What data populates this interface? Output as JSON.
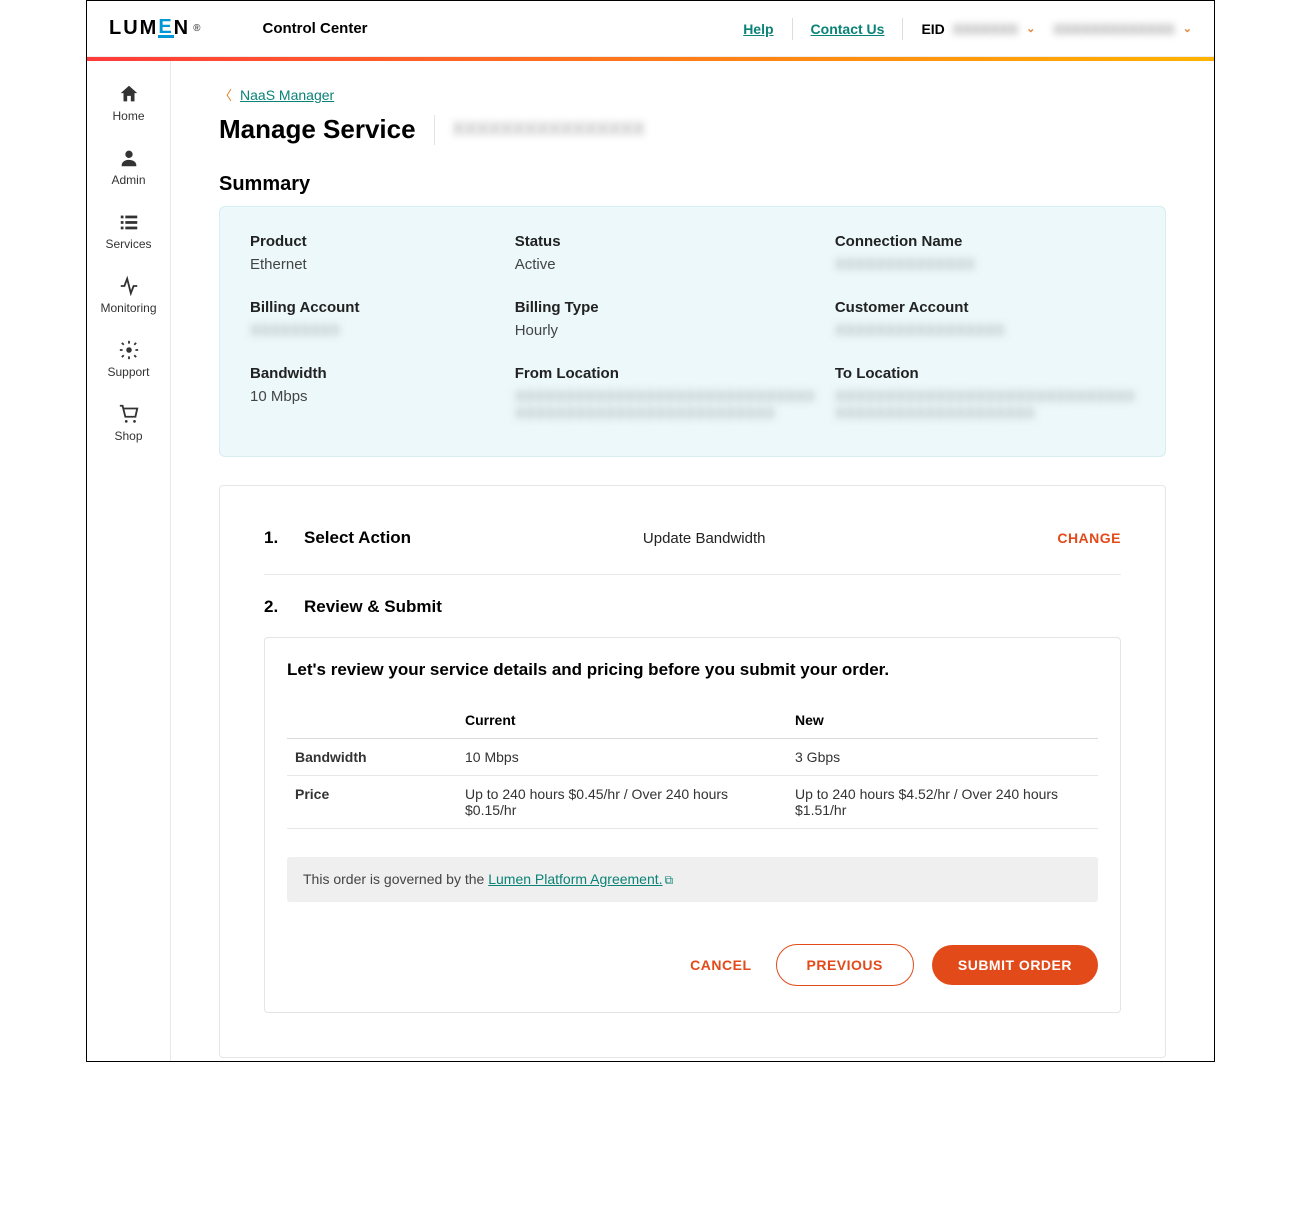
{
  "header": {
    "logo_text": "LUMEN",
    "app_name": "Control Center",
    "help": "Help",
    "contact": "Contact Us",
    "eid_label": "EID",
    "eid_value": "XXXXXXX",
    "user_value": "XXXXXXXXXXXXX"
  },
  "sidebar": {
    "items": [
      {
        "label": "Home"
      },
      {
        "label": "Admin"
      },
      {
        "label": "Services"
      },
      {
        "label": "Monitoring"
      },
      {
        "label": "Support"
      },
      {
        "label": "Shop"
      }
    ]
  },
  "breadcrumb": {
    "link": "NaaS Manager"
  },
  "page": {
    "title": "Manage Service",
    "subtitle": "XXXXXXXXXXXXXXXX"
  },
  "summary": {
    "heading": "Summary",
    "fields": {
      "product": {
        "label": "Product",
        "value": "Ethernet"
      },
      "status": {
        "label": "Status",
        "value": "Active"
      },
      "connection_name": {
        "label": "Connection Name",
        "value": "XXXXXXXXXXXXXX"
      },
      "billing_account": {
        "label": "Billing Account",
        "value": "XXXXXXXXX"
      },
      "billing_type": {
        "label": "Billing Type",
        "value": "Hourly"
      },
      "customer_account": {
        "label": "Customer Account",
        "value": "XXXXXXXXXXXXXXXXX"
      },
      "bandwidth": {
        "label": "Bandwidth",
        "value": "10 Mbps"
      },
      "from_location": {
        "label": "From Location",
        "value": "XXXXXXXXXXXXXXXXXXXXXXXXXXXXXX XXXXXXXXXXXXXXXXXXXXXXXXXX"
      },
      "to_location": {
        "label": "To Location",
        "value": "XXXXXXXXXXXXXXXXXXXXXXXXXXXXXX XXXXXXXXXXXXXXXXXXXX"
      }
    }
  },
  "wizard": {
    "step1": {
      "num": "1.",
      "title": "Select Action",
      "value": "Update Bandwidth",
      "change": "CHANGE"
    },
    "step2": {
      "num": "2.",
      "title": "Review & Submit"
    },
    "review": {
      "heading": "Let's review your service details and pricing before you submit your order.",
      "columns": {
        "current": "Current",
        "new": "New"
      },
      "rows": [
        {
          "label": "Bandwidth",
          "current": "10 Mbps",
          "new": "3 Gbps"
        },
        {
          "label": "Price",
          "current": "Up to 240 hours $0.45/hr / Over 240 hours $0.15/hr",
          "new": "Up to 240 hours $4.52/hr / Over 240 hours $1.51/hr"
        }
      ],
      "agreement_pre": "This order is governed by the ",
      "agreement_link": "Lumen Platform Agreement."
    },
    "actions": {
      "cancel": "CANCEL",
      "previous": "PREVIOUS",
      "submit": "SUBMIT ORDER"
    }
  }
}
